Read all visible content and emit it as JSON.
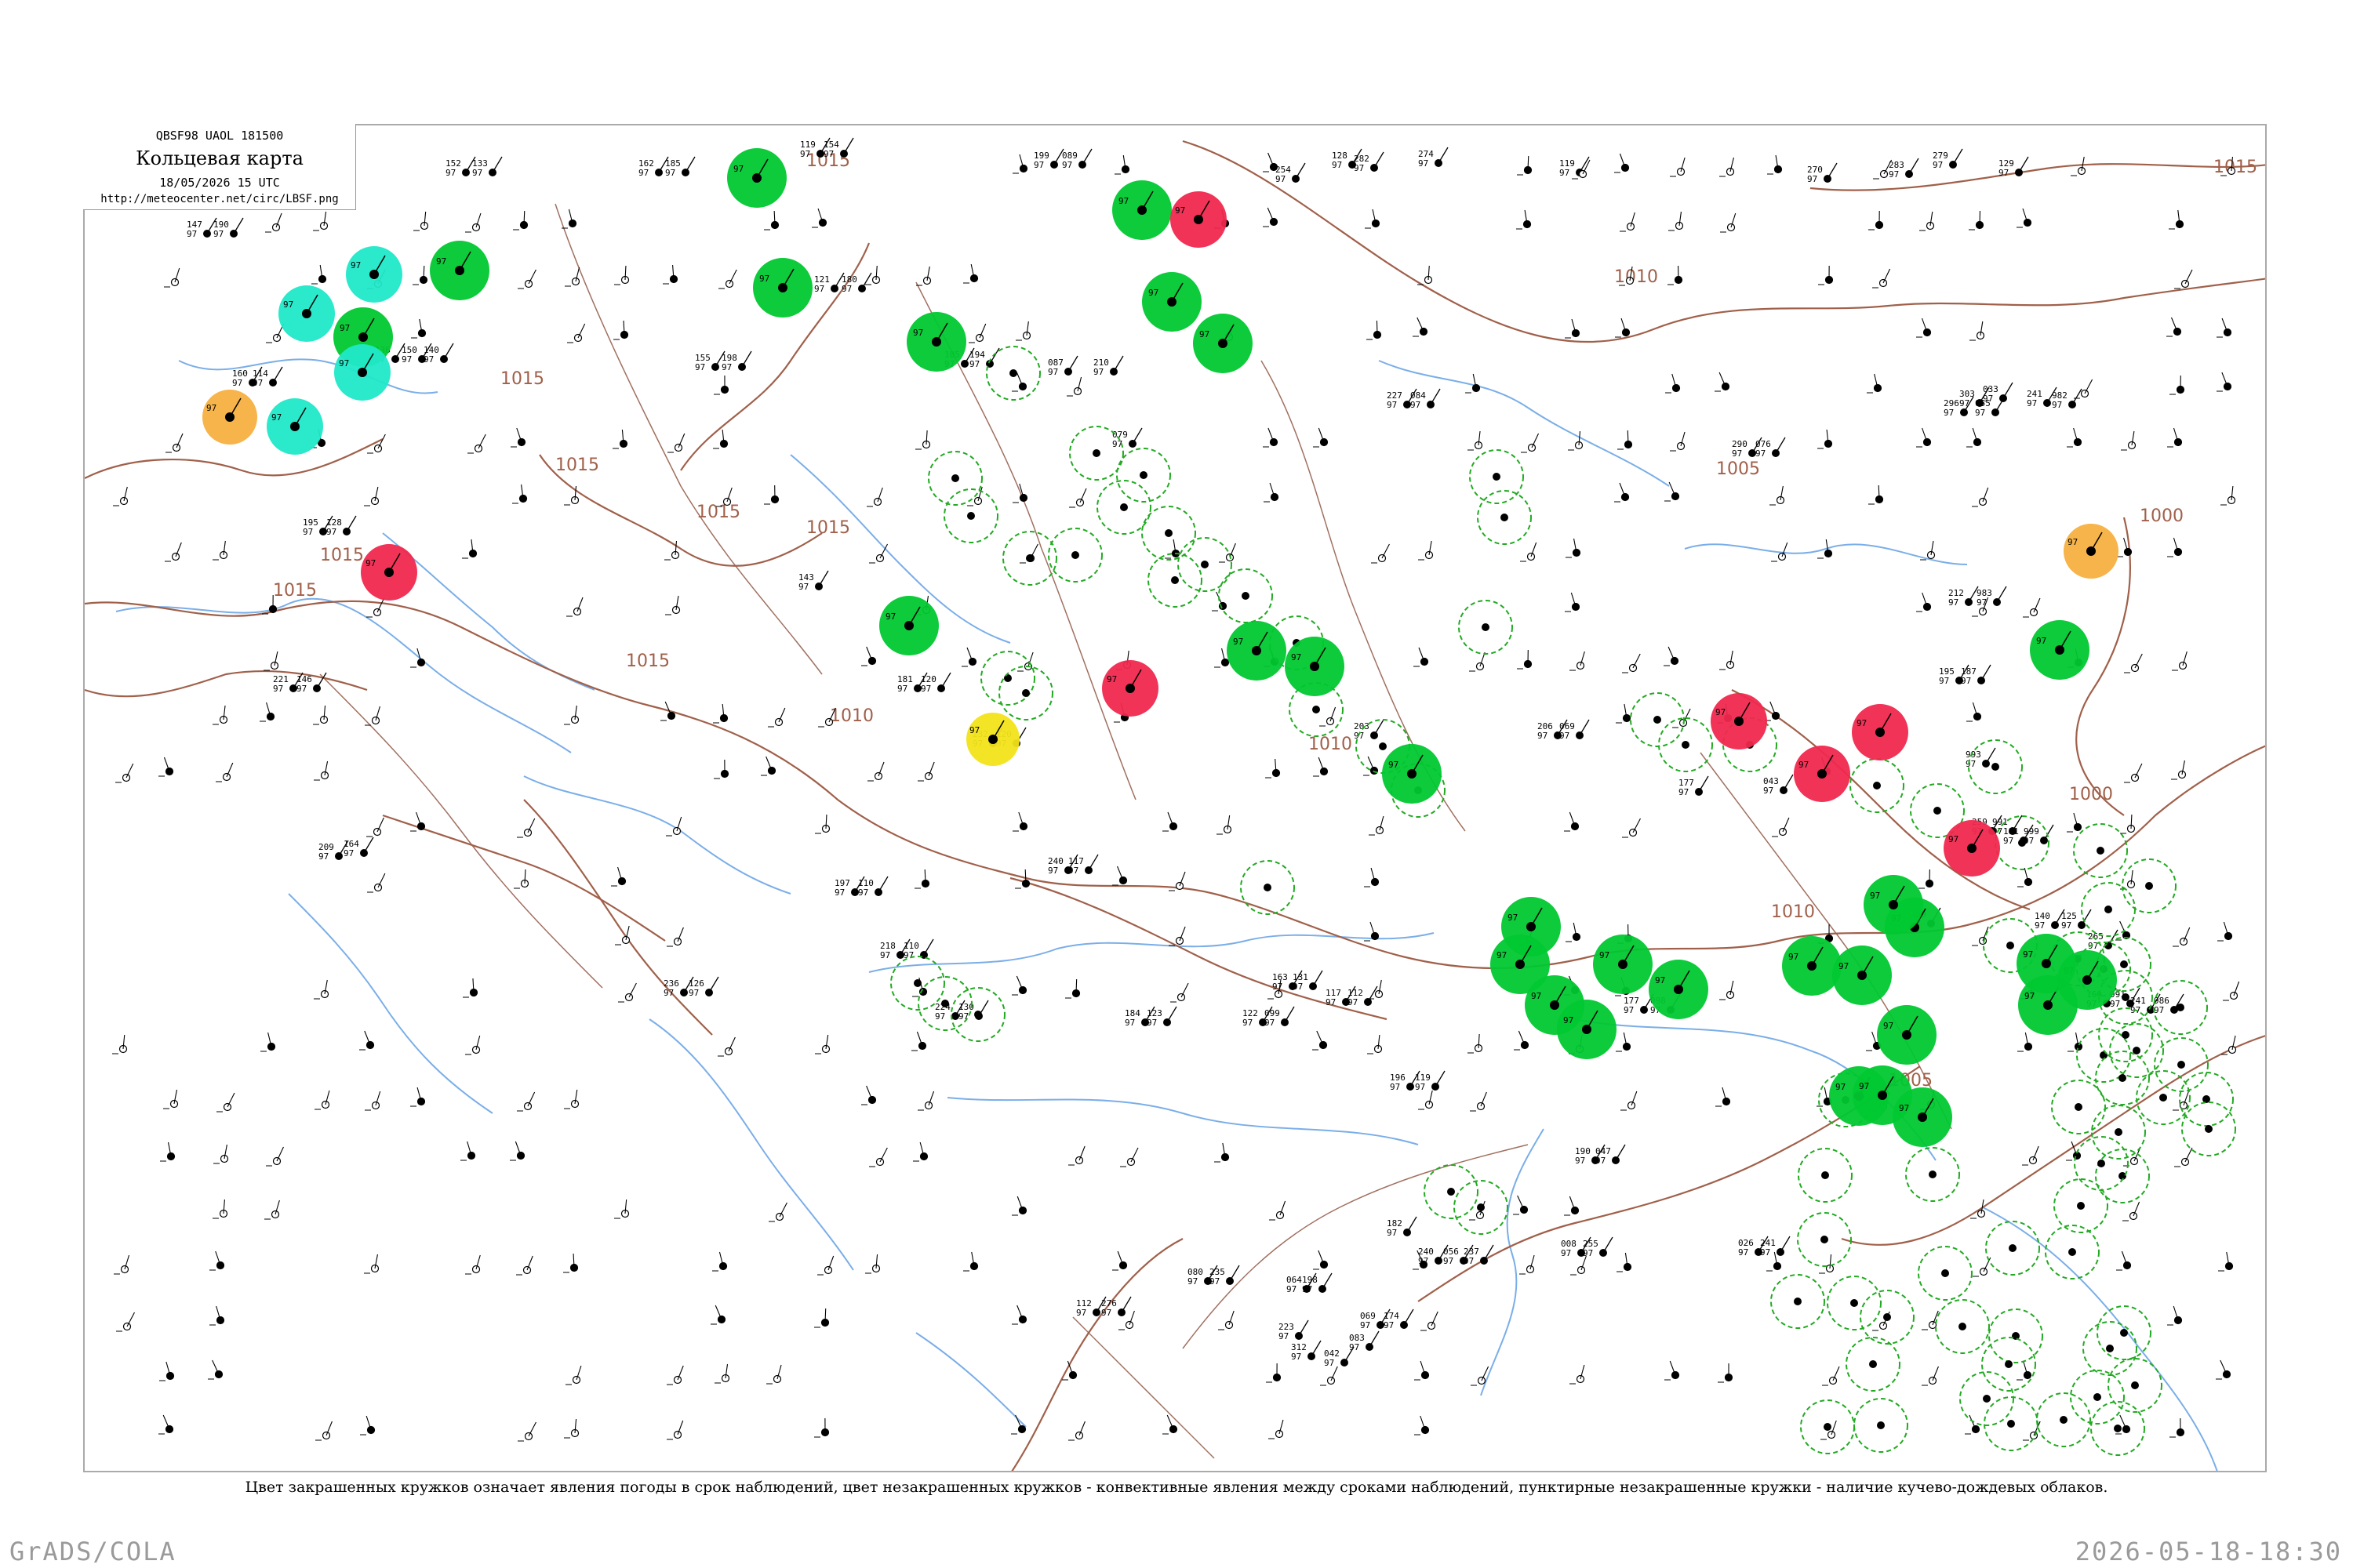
{
  "header": {
    "code": "QBSF98  UAOL  181500",
    "title": "Кольцевая карта",
    "time": "18/05/2026 15 UTC",
    "url": "http://meteocenter.net/circ/LBSF.png"
  },
  "caption": "Цвет закрашенных кружков означает явления погоды в срок наблюдений, цвет незакрашенных кружков - конвективные явления между сроками наблюдений, пунктирные незакрашенные кружки - наличие кучево-дождевых облаков.",
  "footer": {
    "left": "GrADS/COLA",
    "right": "2026-05-18-18:30"
  },
  "colors": {
    "rain": "#00c830",
    "thunder": "#f0284e",
    "snow": "#20e8c8",
    "shower": "#f5b040",
    "fog": "#f2e41a",
    "cb_dashed": "#22aa22",
    "isobar": "#a0604a",
    "coast": "#7aaee8"
  },
  "isobars": [
    {
      "label": "1015"
    },
    {
      "label": "1015"
    },
    {
      "label": "1015"
    },
    {
      "label": "1015"
    },
    {
      "label": "1015"
    },
    {
      "label": "1015"
    },
    {
      "label": "1015"
    },
    {
      "label": "1015"
    },
    {
      "label": "1015"
    },
    {
      "label": "1010"
    },
    {
      "label": "1010"
    },
    {
      "label": "1010"
    },
    {
      "label": "1010"
    },
    {
      "label": "1005"
    },
    {
      "label": "1005"
    },
    {
      "label": "1000"
    },
    {
      "label": "1000"
    }
  ],
  "filled_stations": [
    {
      "kind": "rain"
    },
    {
      "kind": "rain"
    },
    {
      "kind": "rain"
    },
    {
      "kind": "rain"
    },
    {
      "kind": "rain"
    },
    {
      "kind": "rain"
    },
    {
      "kind": "rain"
    },
    {
      "kind": "rain"
    },
    {
      "kind": "rain"
    },
    {
      "kind": "rain"
    },
    {
      "kind": "rain"
    },
    {
      "kind": "rain"
    },
    {
      "kind": "rain"
    },
    {
      "kind": "rain"
    },
    {
      "kind": "rain"
    },
    {
      "kind": "rain"
    },
    {
      "kind": "rain"
    },
    {
      "kind": "rain"
    },
    {
      "kind": "rain"
    },
    {
      "kind": "rain"
    },
    {
      "kind": "rain"
    },
    {
      "kind": "rain"
    },
    {
      "kind": "rain"
    },
    {
      "kind": "rain"
    },
    {
      "kind": "rain"
    },
    {
      "kind": "rain"
    },
    {
      "kind": "rain"
    },
    {
      "kind": "rain"
    },
    {
      "kind": "rain"
    },
    {
      "kind": "rain"
    },
    {
      "kind": "thunder"
    },
    {
      "kind": "thunder"
    },
    {
      "kind": "thunder"
    },
    {
      "kind": "thunder"
    },
    {
      "kind": "thunder"
    },
    {
      "kind": "thunder"
    },
    {
      "kind": "thunder"
    },
    {
      "kind": "snow"
    },
    {
      "kind": "snow"
    },
    {
      "kind": "snow"
    },
    {
      "kind": "snow"
    },
    {
      "kind": "shower"
    },
    {
      "kind": "shower"
    },
    {
      "kind": "fog"
    }
  ],
  "station_readings": [
    {
      "p": "119",
      "t": "97"
    },
    {
      "p": "154",
      "t": "97"
    },
    {
      "p": "152",
      "t": "97"
    },
    {
      "p": "133",
      "t": "97"
    },
    {
      "p": "162",
      "t": "97"
    },
    {
      "p": "185",
      "t": "97"
    },
    {
      "p": "199",
      "t": "97"
    },
    {
      "p": "089",
      "t": "97"
    },
    {
      "p": "254",
      "t": "97"
    },
    {
      "p": "270",
      "t": "97"
    },
    {
      "p": "279",
      "t": "97"
    },
    {
      "p": "128",
      "t": "97"
    },
    {
      "p": "282",
      "t": "97"
    },
    {
      "p": "274",
      "t": "97"
    },
    {
      "p": "119",
      "t": "97"
    },
    {
      "p": "283",
      "t": "97"
    },
    {
      "p": "129",
      "t": "97"
    },
    {
      "p": "147",
      "t": "97"
    },
    {
      "p": "190",
      "t": "97"
    },
    {
      "p": "121",
      "t": "97"
    },
    {
      "p": "180",
      "t": "97"
    },
    {
      "p": "136",
      "t": "97"
    },
    {
      "p": "150",
      "t": "97"
    },
    {
      "p": "140",
      "t": "97"
    },
    {
      "p": "160",
      "t": "97"
    },
    {
      "p": "114",
      "t": "97"
    },
    {
      "p": "155",
      "t": "97"
    },
    {
      "p": "198",
      "t": "97"
    },
    {
      "p": "105",
      "t": "97"
    },
    {
      "p": "194",
      "t": "97"
    },
    {
      "p": "087",
      "t": "97"
    },
    {
      "p": "210",
      "t": "97"
    },
    {
      "p": "079",
      "t": "97"
    },
    {
      "p": "227",
      "t": "97"
    },
    {
      "p": "084",
      "t": "97"
    },
    {
      "p": "290",
      "t": "97"
    },
    {
      "p": "076",
      "t": "97"
    },
    {
      "p": "296",
      "t": "97"
    },
    {
      "p": "055",
      "t": "97"
    },
    {
      "p": "195",
      "t": "97"
    },
    {
      "p": "128",
      "t": "97"
    },
    {
      "p": "143",
      "t": "97"
    },
    {
      "p": "221",
      "t": "97"
    },
    {
      "p": "146",
      "t": "97"
    },
    {
      "p": "181",
      "t": "97"
    },
    {
      "p": "120",
      "t": "97"
    },
    {
      "p": "232",
      "t": "97"
    },
    {
      "p": "120",
      "t": "97"
    },
    {
      "p": "203",
      "t": "97"
    },
    {
      "p": "206",
      "t": "97"
    },
    {
      "p": "069",
      "t": "97"
    },
    {
      "p": "177",
      "t": "97"
    },
    {
      "p": "043",
      "t": "97"
    },
    {
      "p": "181",
      "t": "97"
    },
    {
      "p": "999",
      "t": "97"
    },
    {
      "p": "209",
      "t": "97"
    },
    {
      "p": "164",
      "t": "97"
    },
    {
      "p": "240",
      "t": "97"
    },
    {
      "p": "117",
      "t": "97"
    },
    {
      "p": "197",
      "t": "97"
    },
    {
      "p": "110",
      "t": "97"
    },
    {
      "p": "218",
      "t": "97"
    },
    {
      "p": "110",
      "t": "97"
    },
    {
      "p": "163",
      "t": "97"
    },
    {
      "p": "131",
      "t": "97"
    },
    {
      "p": "117",
      "t": "97"
    },
    {
      "p": "112",
      "t": "97"
    },
    {
      "p": "177",
      "t": "97"
    },
    {
      "p": "098",
      "t": "97"
    },
    {
      "p": "169",
      "t": "97"
    },
    {
      "p": "991",
      "t": "97"
    },
    {
      "p": "241",
      "t": "97"
    },
    {
      "p": "986",
      "t": "97"
    },
    {
      "p": "236",
      "t": "97"
    },
    {
      "p": "126",
      "t": "97"
    },
    {
      "p": "224",
      "t": "97"
    },
    {
      "p": "130",
      "t": "97"
    },
    {
      "p": "184",
      "t": "97"
    },
    {
      "p": "123",
      "t": "97"
    },
    {
      "p": "122",
      "t": "97"
    },
    {
      "p": "099",
      "t": "97"
    },
    {
      "p": "196",
      "t": "97"
    },
    {
      "p": "119",
      "t": "97"
    },
    {
      "p": "190",
      "t": "97"
    },
    {
      "p": "047",
      "t": "97"
    },
    {
      "p": "182",
      "t": "97"
    },
    {
      "p": "240",
      "t": "97"
    },
    {
      "p": "056",
      "t": "97"
    },
    {
      "p": "237",
      "t": "97"
    },
    {
      "p": "008",
      "t": "97"
    },
    {
      "p": "255",
      "t": "97"
    },
    {
      "p": "026",
      "t": "97"
    },
    {
      "p": "241",
      "t": "97"
    },
    {
      "p": "080",
      "t": "97"
    },
    {
      "p": "235",
      "t": "97"
    },
    {
      "p": "064",
      "t": "97"
    },
    {
      "p": "198",
      "t": "97"
    },
    {
      "p": "223",
      "t": "97"
    },
    {
      "p": "112",
      "t": "97"
    },
    {
      "p": "276",
      "t": "97"
    },
    {
      "p": "069",
      "t": "97"
    },
    {
      "p": "174",
      "t": "97"
    },
    {
      "p": "083",
      "t": "97"
    },
    {
      "p": "312",
      "t": "97"
    },
    {
      "p": "042",
      "t": "97"
    },
    {
      "p": "303",
      "t": "97"
    },
    {
      "p": "033",
      "t": "97"
    },
    {
      "p": "241",
      "t": "97"
    },
    {
      "p": "982",
      "t": "97"
    },
    {
      "p": "212",
      "t": "97"
    },
    {
      "p": "983",
      "t": "97"
    },
    {
      "p": "195",
      "t": "97"
    },
    {
      "p": "187",
      "t": "97"
    },
    {
      "p": "993",
      "t": "97"
    },
    {
      "p": "259",
      "t": "97"
    },
    {
      "p": "991",
      "t": "97"
    },
    {
      "p": "140",
      "t": "97"
    },
    {
      "p": "125",
      "t": "97"
    },
    {
      "p": "265",
      "t": "97"
    },
    {
      "p": "109",
      "t": "97"
    }
  ]
}
